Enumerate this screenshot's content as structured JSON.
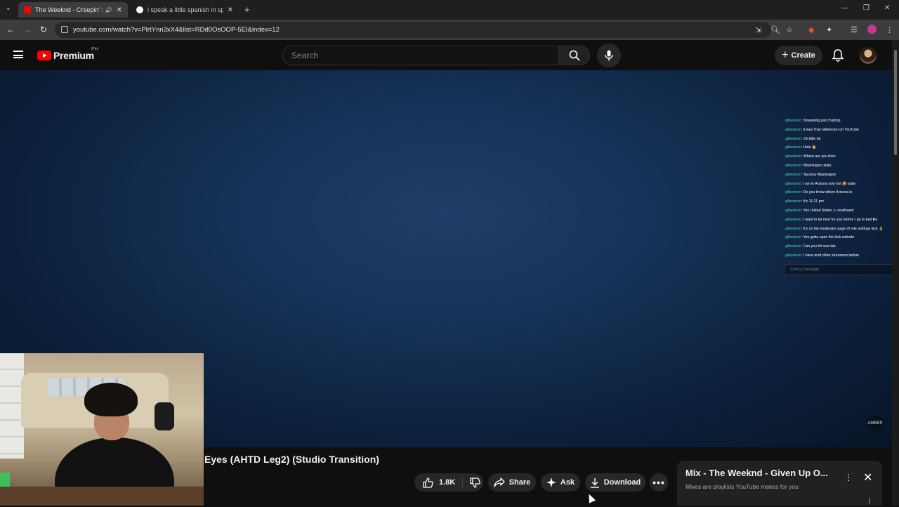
{
  "browser": {
    "tabs": [
      {
        "title": "The Weeknd - Creepin' x P...",
        "active": true
      },
      {
        "title": "i speak a little spanish in spanish",
        "active": false
      }
    ],
    "url": "youtube.com/watch?v=PlrtYnn3xX4&list=RDd0OsOOP-5EI&index=12",
    "new_tab": "+"
  },
  "header": {
    "brand": "Premium",
    "country": "PH",
    "search_placeholder": "Search",
    "create_label": "Create"
  },
  "chat": {
    "username": "gilbertoon",
    "messages": [
      "Streaming just chatting",
      "it was Trae Gilbertson on YouTube",
      "Oh little bit",
      "Hola 👋",
      "Where are you from",
      "Washington state",
      "Tacoma Washington",
      "I am in Arizona now hot 🥵 state",
      "Do you know where Arizona is",
      "It's 11:21 pm",
      "Yes United States ⚠ southwest",
      "I want to be mod for you before I go to bed 🛏",
      "It's on the moderator page of role settings kick 👌",
      "You gotta open the kick website",
      "Can you hit new tab",
      "I have mod other streamers before"
    ],
    "input_placeholder": "Send a message"
  },
  "watermark": "AMBER",
  "video": {
    "title": "Eyes (AHTD Leg2) (Studio Transition)"
  },
  "actions": {
    "likes": "1.8K",
    "share": "Share",
    "ask": "Ask",
    "download": "Download"
  },
  "mix": {
    "title": "Mix - The Weeknd - Given Up O...",
    "subtitle": "Mixes are playlists YouTube makes for you"
  },
  "colors": {
    "brand_red": "#ff0000",
    "chat_username": "#4fd6a5",
    "background": "#0f0f0f"
  }
}
